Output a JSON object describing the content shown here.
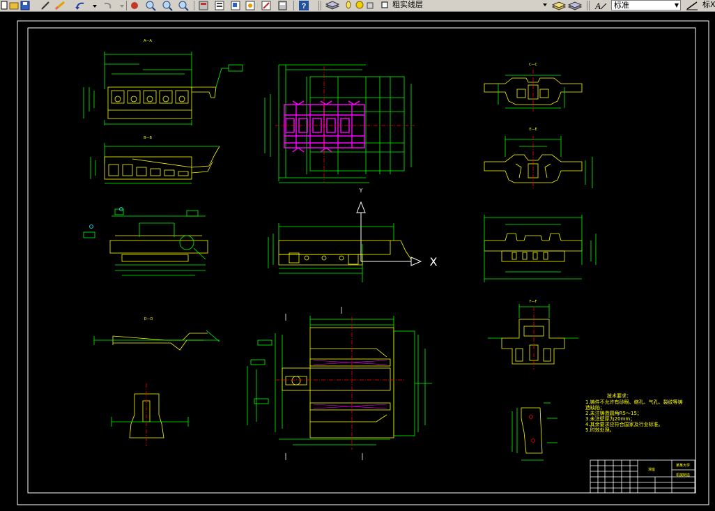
{
  "toolbar": {
    "layer_combo": {
      "value": "粗实线层"
    },
    "textstyle_combo": {
      "value": "标准"
    },
    "dimstyle_partial": "标X"
  },
  "drawing": {
    "sections": {
      "a": "A—A",
      "b": "B—B",
      "c": "C—C",
      "d": "D—D",
      "e": "E—E",
      "f": "F—F"
    },
    "ucs": {
      "x": "X",
      "y": "Y"
    },
    "tech_req": {
      "title": "技术要求：",
      "lines": [
        "1.铸件不允许有砂眼、缩孔、气孔、裂纹等铸",
        "造缺陷；",
        "2.未注铸造圆角R5～15；",
        "3.未注壁厚为20mm；",
        "4.其余要求应符合国家及行业标准。",
        "5.时效处理。"
      ]
    },
    "title_block": {
      "name": "滑座",
      "school": "某某大学",
      "drawing_no": "机械制造"
    }
  },
  "colors": {
    "frame": "#ffffff",
    "part": "#ffff00",
    "dim": "#00ff00",
    "hatch": "#ff00ff",
    "text": "#ffff00",
    "center": "#ff0000"
  }
}
